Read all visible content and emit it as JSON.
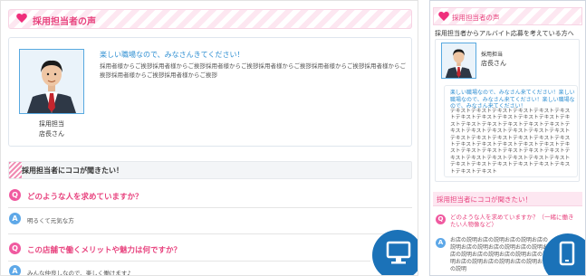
{
  "pc": {
    "header_title": "採用担当者の声",
    "profile": {
      "role": "採用担当",
      "name": "店長さん",
      "catch": "楽しい職場なので、みなさんきてください！",
      "body": "採用者様からご挨拶採用者様からご挨拶採用者様からご挨拶採用者様からご挨拶採用者様からご挨拶採用者様からご挨拶採用者様からご挨拶採用者様からご挨拶"
    },
    "qa_header": "採用担当者にココが聞きたい！",
    "qa": [
      {
        "q_badge": "Q",
        "question": "どのような人を求めていますか？",
        "a_badge": "A",
        "answer": "明るくて元気な方"
      },
      {
        "q_badge": "Q",
        "question": "この店舗で働くメリットや魅力は何ですか？",
        "a_badge": "A",
        "answer": "みんな仲良しなので、楽しく働けます♪"
      }
    ],
    "device_icon": "desktop-monitor-icon"
  },
  "sp": {
    "header_title": "採用担当者の声",
    "lead": "採用担当者からアルバイト応募を考えている方へ",
    "profile": {
      "role": "採用担当",
      "name": "店長さん",
      "catch": "楽しい職場なので、みなさん来てください！楽しい職場なので、みなさん来てください！楽しい職場なので、みなさん来てください！",
      "body": "テキストテキストテキストテキストテキストテキストテキストテキストテキストテキストテキストテキストテキストテキストテキストテキストテキストテキストテキストテキストテキストテキストテキストテキストテキストテキストテキストテキストテキストテキストテキストテキストテキストテキストテキストテキストテキストテキストテキストテキストテキストテキストテキストテキストテキストテキストテキストテキストテキストテキストテキストテキストテキストテキスト"
    },
    "qa_header": "採用担当者にココが聞きたい！",
    "qa": [
      {
        "q_badge": "Q",
        "question": "どのような人を求めていますか？（一緒に働きたい人物像など）",
        "a_badge": "A",
        "answer": "お店の説明お店の説明お店の説明お店の説明お店の説明お店の説明お店の説明お店の説明お店の説明お店の説明お店の説明お店の説明お店の説明お店の説明お店の説明"
      }
    ],
    "device_icon": "smartphone-icon"
  },
  "colors": {
    "pink": "#e8447f",
    "blue": "#2f8fd2",
    "device": "#1b72b8"
  }
}
